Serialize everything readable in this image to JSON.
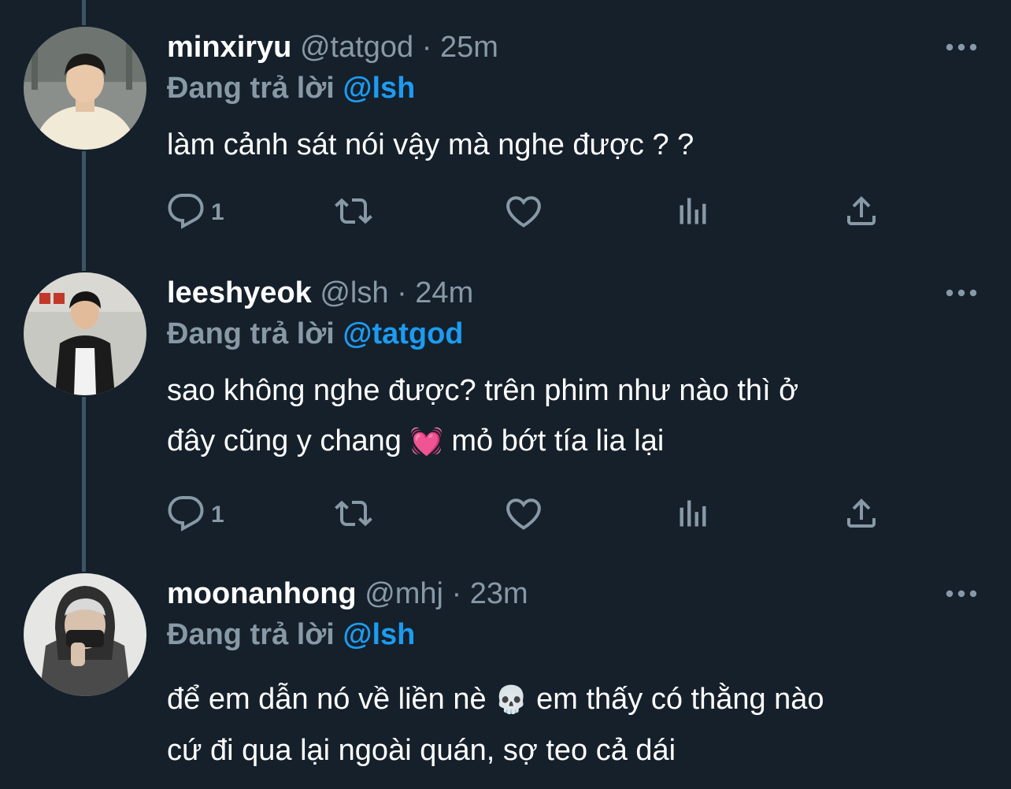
{
  "tweets": [
    {
      "name": "minxiryu",
      "handle": "@tatgod",
      "separator": "·",
      "time": "25m",
      "replying_label": "Đang trả lời",
      "replying_to": "@lsh",
      "text_lines": [
        "làm cảnh sát nói vậy mà nghe được ? ?"
      ],
      "reply_count": "1"
    },
    {
      "name": "leeshyeok",
      "handle": "@lsh",
      "separator": "·",
      "time": "24m",
      "replying_label": "Đang trả lời",
      "replying_to": "@tatgod",
      "text_line1": "sao không nghe được? trên phim như nào thì ở",
      "text_line2_a": "đây cũng y chang",
      "text_line2_emoji": "💓",
      "text_line2_b": "mỏ bớt tía lia lại",
      "reply_count": "1"
    },
    {
      "name": "moonanhong",
      "handle": "@mhj",
      "separator": "·",
      "time": "23m",
      "replying_label": "Đang trả lời",
      "replying_to": "@lsh",
      "text_line1_a": "để em dẫn nó về liền nè",
      "text_line1_emoji": "💀",
      "text_line1_b": "em thấy có thằng nào",
      "text_line2": "cứ đi qua lại ngoài quán, sợ teo cả dái"
    }
  ],
  "icons": {
    "reply": "reply-icon",
    "retweet": "retweet-icon",
    "like": "heart-icon",
    "analytics": "analytics-icon",
    "share": "share-icon",
    "more": "more-icon"
  },
  "colors": {
    "background": "#15202b",
    "text": "#ffffff",
    "secondary": "#8899a6",
    "mention": "#1d9bf0",
    "thread_line": "#3d5466"
  }
}
